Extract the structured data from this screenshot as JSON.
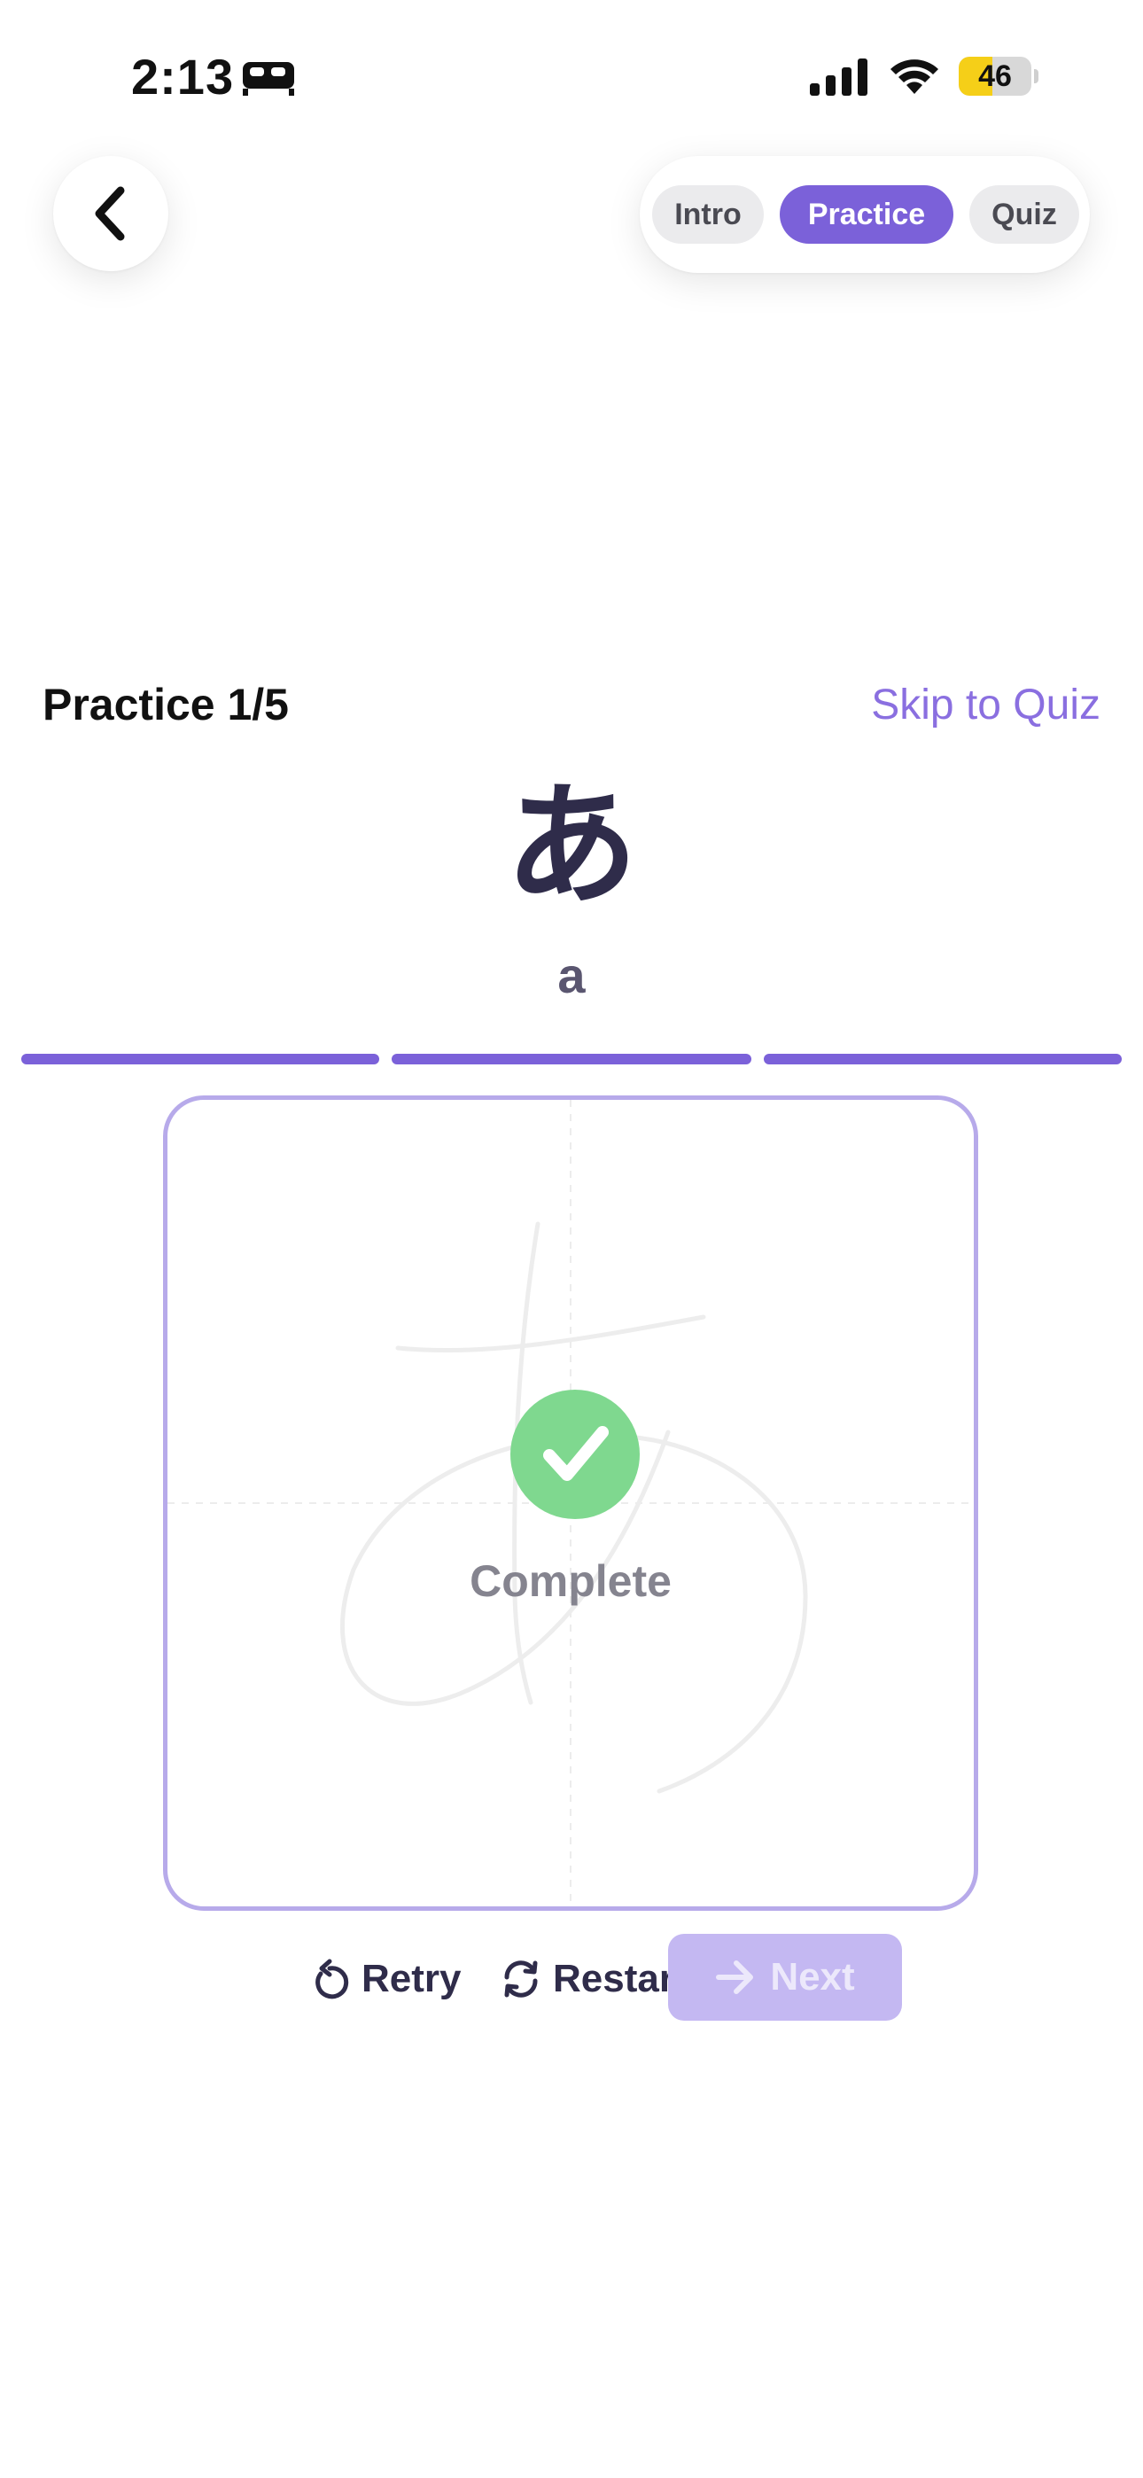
{
  "status_bar": {
    "time": "2:13",
    "battery_level": "46",
    "battery_fraction": 0.46,
    "icons": [
      "bed-icon",
      "signal-icon",
      "wifi-icon",
      "battery-icon"
    ]
  },
  "header": {
    "back_icon": "chevron-left-icon",
    "tabs": [
      {
        "label": "Intro",
        "active": false
      },
      {
        "label": "Practice",
        "active": true
      },
      {
        "label": "Quiz",
        "active": false
      }
    ]
  },
  "practice": {
    "title": "Practice 1/5",
    "skip_label": "Skip to Quiz",
    "character": "あ",
    "romaji": "a",
    "strokes_total": 3,
    "strokes_completed": 3,
    "status_label": "Complete",
    "status_icon": "checkmark-icon"
  },
  "actions": {
    "retry_label": "Retry",
    "restart_label": "Restart",
    "next_label": "Next"
  },
  "colors": {
    "accent": "#7b61d9",
    "accent_light": "#c4b8f2",
    "success": "#7fd88f",
    "text_dark": "#2f2c4a"
  }
}
